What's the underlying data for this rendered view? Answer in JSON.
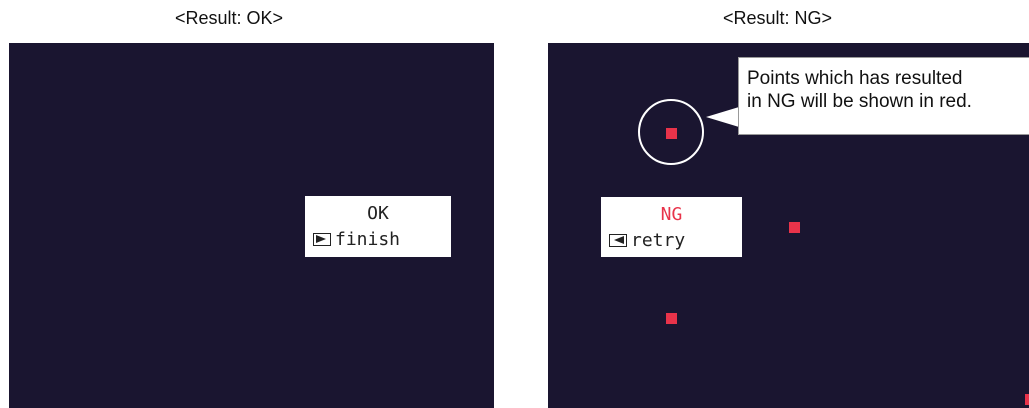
{
  "left_panel": {
    "caption": "<Result: OK>",
    "status": "OK",
    "action_label": "finish",
    "action_icon": "right-arrow-key-icon"
  },
  "right_panel": {
    "caption": "<Result: NG>",
    "status": "NG",
    "action_label": "retry",
    "action_icon": "left-arrow-key-icon",
    "callout_lines": [
      "Points which has resulted",
      "in NG will be shown in red."
    ]
  },
  "colors": {
    "screen_background": "#1a1530",
    "ng_point": "#e8334a",
    "ng_text": "#e8334a"
  }
}
